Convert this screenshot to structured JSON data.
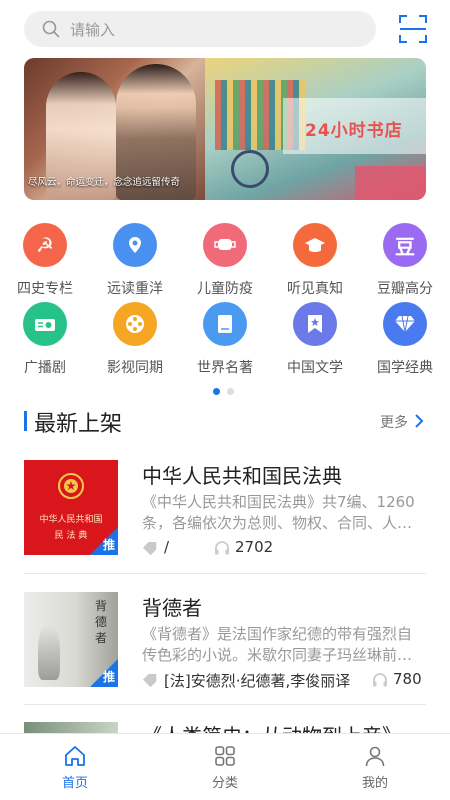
{
  "search": {
    "placeholder": "请输入"
  },
  "banner": {
    "slides": [
      {
        "caption": "尽风云，命运变迁，念念追远留传奇"
      },
      {
        "caption": "24小时书店"
      }
    ],
    "active_index": 1
  },
  "categories": [
    {
      "label": "四史专栏",
      "icon": "party-emblem-icon",
      "color": "#f5654a"
    },
    {
      "label": "远读重洋",
      "icon": "map-pin-icon",
      "color": "#4a90f0"
    },
    {
      "label": "儿童防疫",
      "icon": "mask-icon",
      "color": "#f06a7a"
    },
    {
      "label": "听见真知",
      "icon": "graduation-cap-icon",
      "color": "#f56a3c"
    },
    {
      "label": "豆瓣高分",
      "icon": "douban-icon",
      "color": "#9a6af0"
    },
    {
      "label": "广播剧",
      "icon": "radio-icon",
      "color": "#27c28a"
    },
    {
      "label": "影视同期",
      "icon": "film-reel-icon",
      "color": "#f5a623"
    },
    {
      "label": "世界名著",
      "icon": "book-icon",
      "color": "#4a9af0"
    },
    {
      "label": "中国文学",
      "icon": "bookmark-star-icon",
      "color": "#6a7ae8"
    },
    {
      "label": "国学经典",
      "icon": "diamond-icon",
      "color": "#4a7af0"
    }
  ],
  "grid_page": {
    "count": 2,
    "active": 0
  },
  "section": {
    "title": "最新上架",
    "more": "更多"
  },
  "books": [
    {
      "title": "中华人民共和国民法典",
      "desc": "《中华人民共和国民法典》共7编、1260条，各编依次为总则、物权、合同、人…",
      "author": "/",
      "plays": "2702",
      "badge": "推",
      "cover_text": [
        "中华人民共和国",
        "民 法 典"
      ]
    },
    {
      "title": "背德者",
      "desc": "《背德者》是法国作家纪德的带有强烈自传色彩的小说。米歇尔同妻子玛丝琳前…",
      "author": "[法]安德烈·纪德著,李俊丽译",
      "plays": "780",
      "badge": "推",
      "cover_text": [
        "背",
        "德",
        "者"
      ]
    },
    {
      "title": "《人类简史：从动物到上帝》"
    }
  ],
  "bottom_nav": [
    {
      "label": "首页",
      "icon": "home-icon",
      "active": true
    },
    {
      "label": "分类",
      "icon": "grid-icon",
      "active": false
    },
    {
      "label": "我的",
      "icon": "user-icon",
      "active": false
    }
  ],
  "colors": {
    "accent": "#1a73e8",
    "badge": "#1a73e8"
  }
}
